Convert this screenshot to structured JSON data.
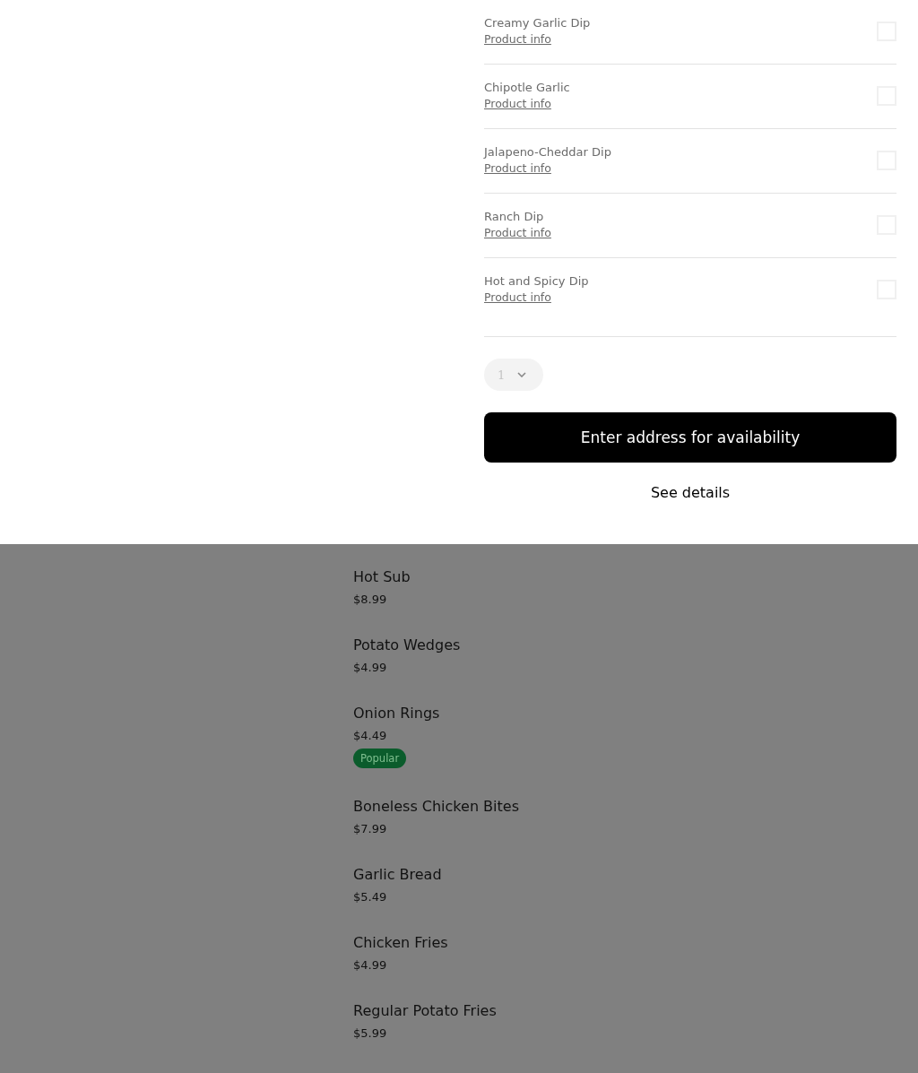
{
  "options": [
    {
      "name": "Creamy Garlic Dip",
      "link": "Product info",
      "checked": false
    },
    {
      "name": "Chipotle Garlic",
      "link": "Product info",
      "checked": false
    },
    {
      "name": "Jalapeno-Cheddar Dip",
      "link": "Product info",
      "checked": false
    },
    {
      "name": "Ranch Dip",
      "link": "Product info",
      "checked": false
    },
    {
      "name": "Hot and Spicy Dip",
      "link": "Product info",
      "checked": false
    }
  ],
  "quantity": {
    "value": "1",
    "disabled": true
  },
  "primary_button": "Enter address for availability",
  "details_link": "See details",
  "menu_items": [
    {
      "name": "Hot Sub",
      "price": "$8.99"
    },
    {
      "name": "Potato Wedges",
      "price": "$4.99"
    },
    {
      "name": "Onion Rings",
      "price": "$4.49",
      "badge": "Popular"
    },
    {
      "name": "Boneless Chicken Bites",
      "price": "$7.99"
    },
    {
      "name": "Garlic Bread",
      "price": "$5.49"
    },
    {
      "name": "Chicken Fries",
      "price": "$4.99"
    },
    {
      "name": "Regular Potato Fries",
      "price": "$5.99"
    }
  ]
}
